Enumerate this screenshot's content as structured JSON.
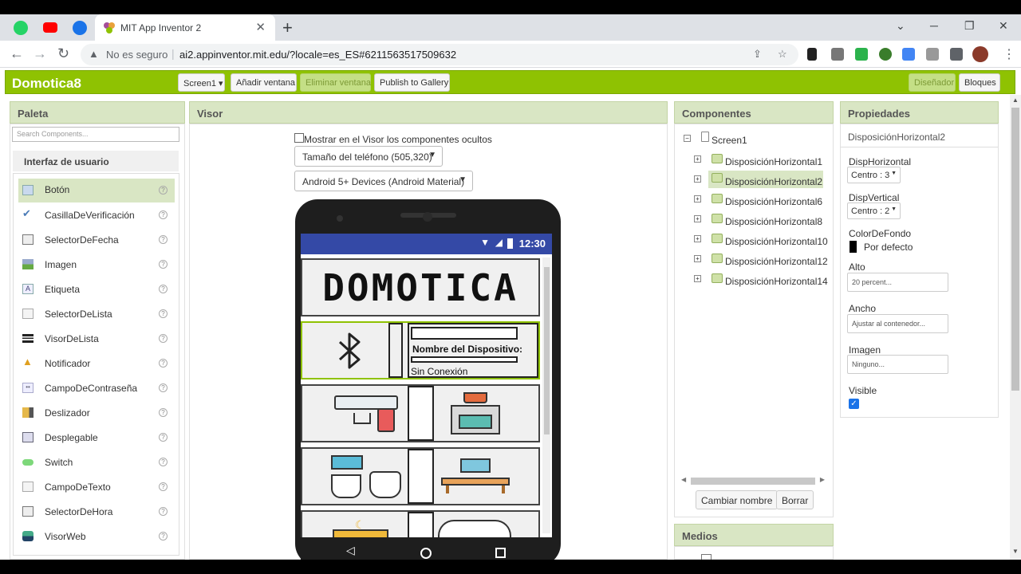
{
  "browser": {
    "tab_title": "MIT App Inventor 2",
    "security_label": "No es seguro",
    "url": "ai2.appinventor.mit.edu/?locale=es_ES#6211563517509632"
  },
  "app": {
    "project_name": "Domotica8",
    "screen_select": "Screen1",
    "add_screen": "Añadir ventana",
    "remove_screen": "Eliminar ventana",
    "publish": "Publish to Gallery",
    "designer": "Diseñador",
    "blocks": "Bloques"
  },
  "palette": {
    "title": "Paleta",
    "search_placeholder": "Search Components...",
    "category": "Interfaz de usuario",
    "items": [
      {
        "label": "Botón"
      },
      {
        "label": "CasillaDeVerificación"
      },
      {
        "label": "SelectorDeFecha"
      },
      {
        "label": "Imagen"
      },
      {
        "label": "Etiqueta"
      },
      {
        "label": "SelectorDeLista"
      },
      {
        "label": "VisorDeLista"
      },
      {
        "label": "Notificador"
      },
      {
        "label": "CampoDeContraseña"
      },
      {
        "label": "Deslizador"
      },
      {
        "label": "Desplegable"
      },
      {
        "label": "Switch"
      },
      {
        "label": "CampoDeTexto"
      },
      {
        "label": "SelectorDeHora"
      },
      {
        "label": "VisorWeb"
      }
    ],
    "help_glyph": "?"
  },
  "viewer": {
    "title": "Visor",
    "show_hidden": "Mostrar en el Visor los componentes ocultos",
    "phone_size": "Tamaño del teléfono (505,320)",
    "theme": "Android 5+ Devices (Android Material)",
    "clock": "12:30",
    "app_heading": "DOMOTICA",
    "device_label": "Nombre del Dispositivo:",
    "connection_status": "Sin Conexión"
  },
  "components": {
    "title": "Componentes",
    "root": "Screen1",
    "items": [
      "DisposiciónHorizontal1",
      "DisposiciónHorizontal2",
      "DisposiciónHorizontal6",
      "DisposiciónHorizontal8",
      "DisposiciónHorizontal10",
      "DisposiciónHorizontal12",
      "DisposiciónHorizontal14"
    ],
    "rename": "Cambiar nombre",
    "delete": "Borrar"
  },
  "media": {
    "title": "Medios"
  },
  "properties": {
    "title": "Propiedades",
    "selected": "DisposiciónHorizontal2",
    "disp_horizontal_label": "DispHorizontal",
    "disp_horizontal_value": "Centro : 3",
    "disp_vertical_label": "DispVertical",
    "disp_vertical_value": "Centro : 2",
    "bg_label": "ColorDeFondo",
    "bg_value": "Por defecto",
    "alto_label": "Alto",
    "alto_value": "20 percent...",
    "ancho_label": "Ancho",
    "ancho_value": "Ajustar al contenedor...",
    "imagen_label": "Imagen",
    "imagen_value": "Ninguno...",
    "visible_label": "Visible"
  },
  "colors": {
    "accent_green": "#8fc202",
    "status_bar": "#3449a6"
  }
}
